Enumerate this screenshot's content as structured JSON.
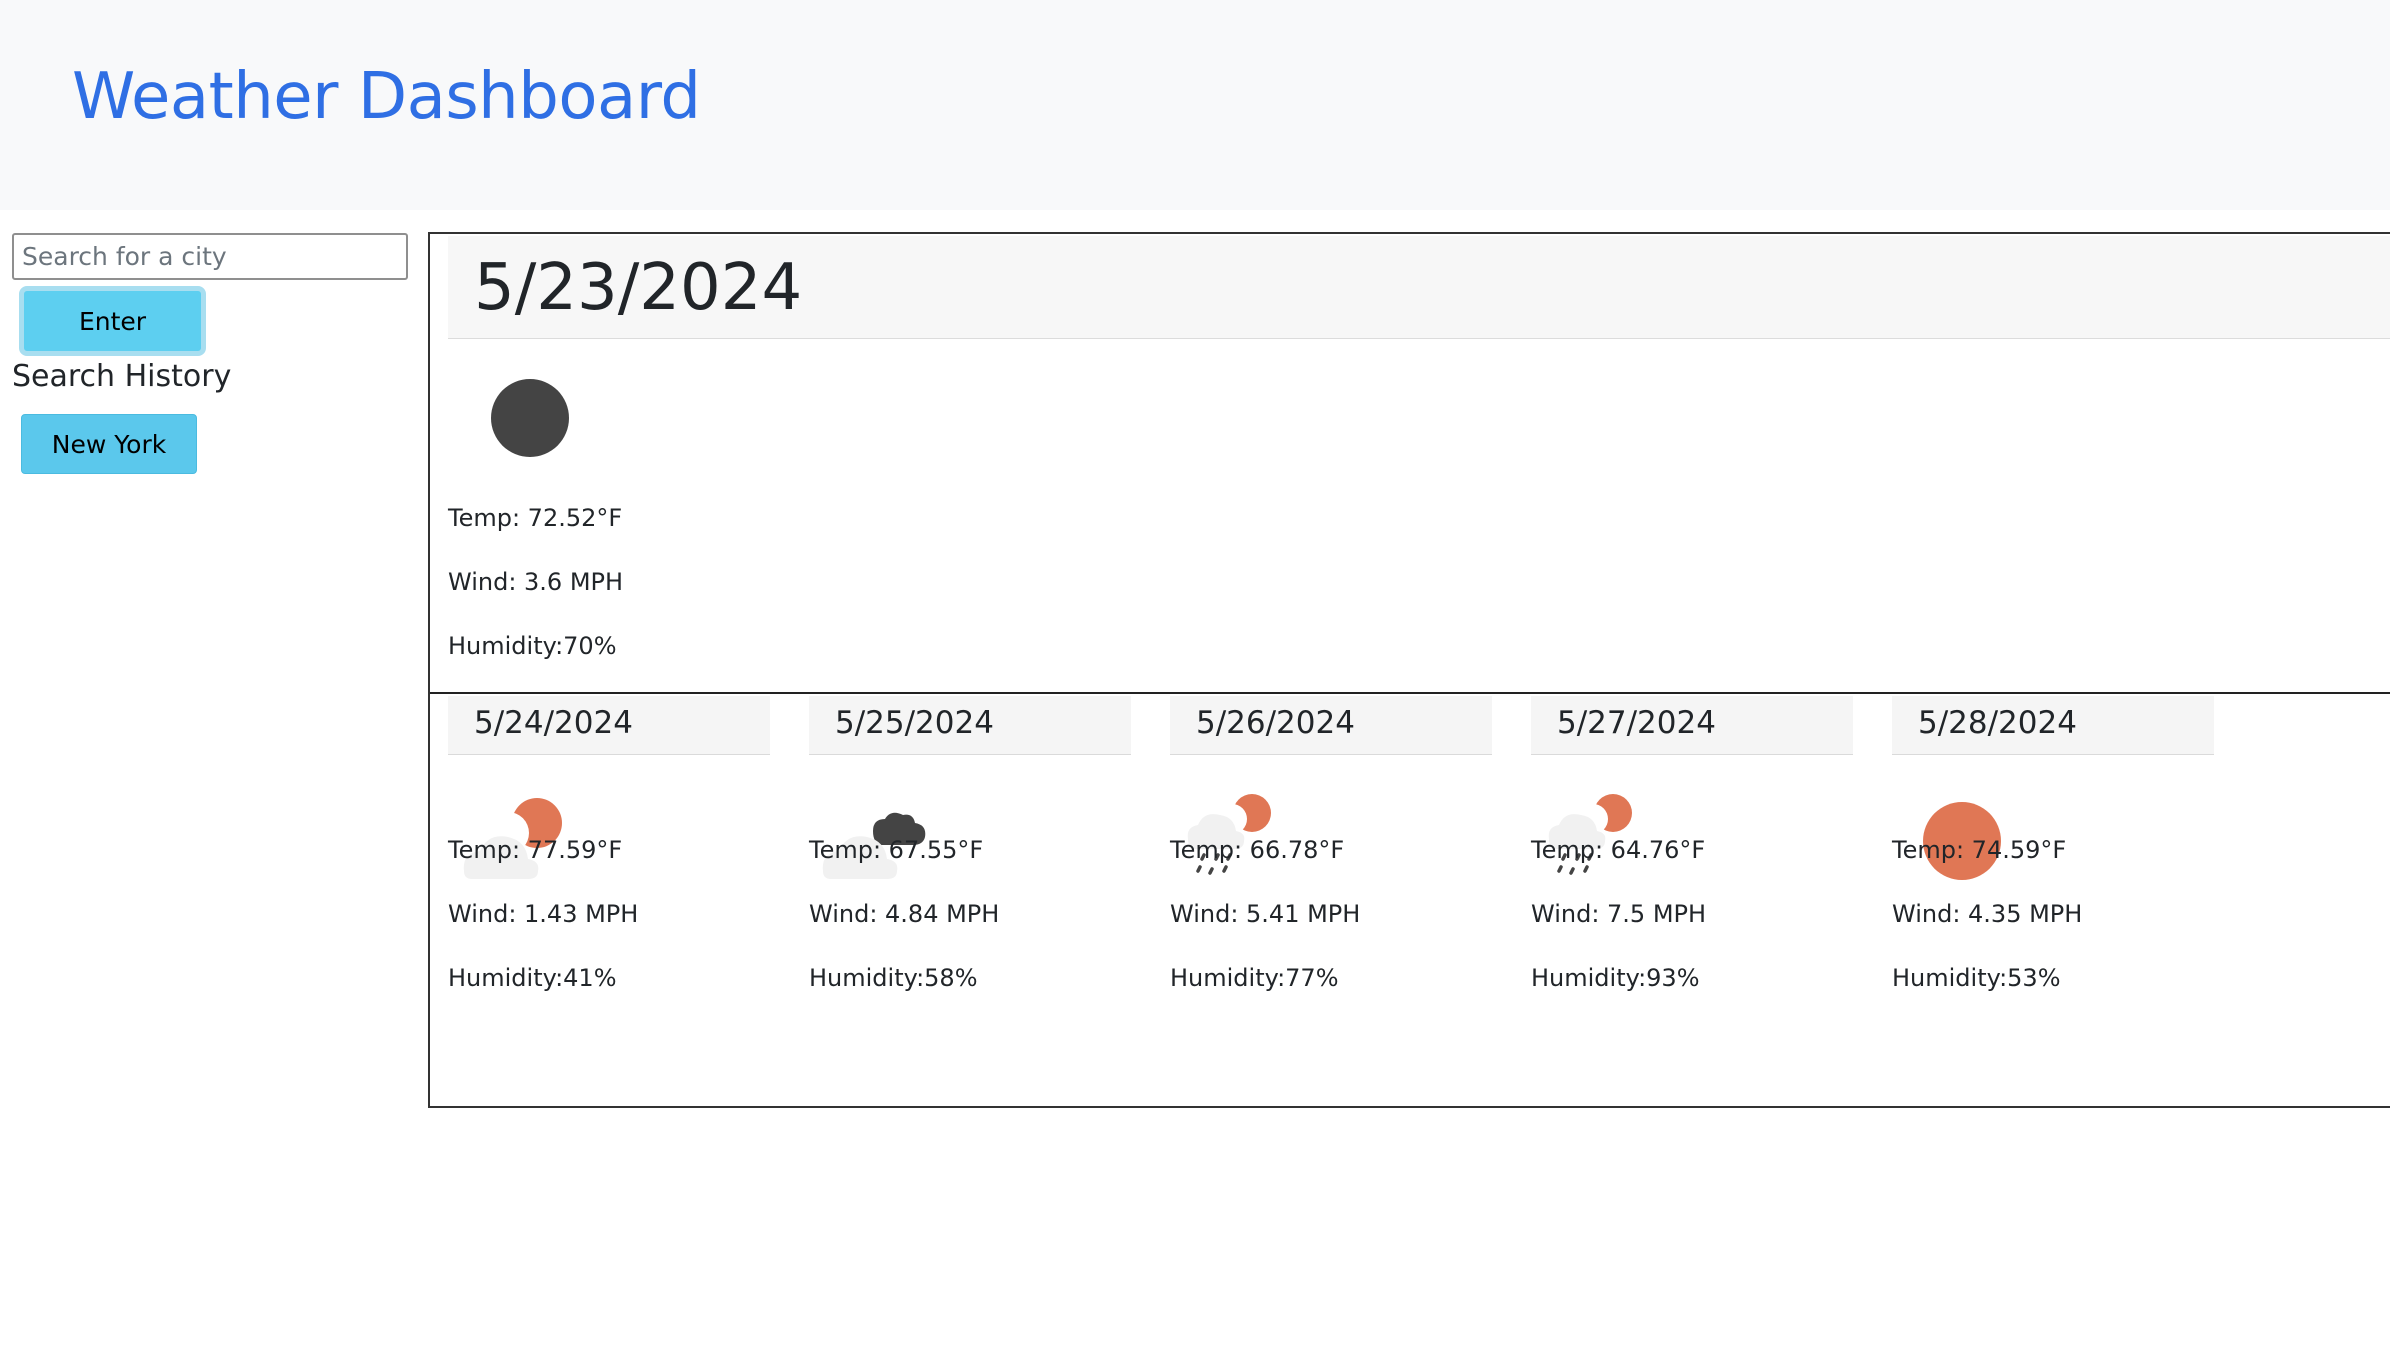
{
  "header": {
    "title": "Weather Dashboard"
  },
  "search": {
    "placeholder": "Search for a city",
    "value": "",
    "button_label": "Enter"
  },
  "history": {
    "title": "Search History",
    "items": [
      "New York"
    ]
  },
  "today": {
    "date": "5/23/2024",
    "icon": "moon-icon",
    "temp": "Temp: 72.52°F",
    "wind": "Wind: 3.6 MPH",
    "humidity": "Humidity:70%"
  },
  "forecast": [
    {
      "date": "5/24/2024",
      "icon": "partly-cloudy-sun-icon",
      "temp": "Temp: 77.59°F",
      "wind": "Wind: 1.43 MPH",
      "humidity": "Humidity:41%"
    },
    {
      "date": "5/25/2024",
      "icon": "cloudy-icon",
      "temp": "Temp: 67.55°F",
      "wind": "Wind: 4.84 MPH",
      "humidity": "Humidity:58%"
    },
    {
      "date": "5/26/2024",
      "icon": "rain-sun-icon",
      "temp": "Temp: 66.78°F",
      "wind": "Wind: 5.41 MPH",
      "humidity": "Humidity:77%"
    },
    {
      "date": "5/27/2024",
      "icon": "rain-sun-icon",
      "temp": "Temp: 64.76°F",
      "wind": "Wind: 7.5 MPH",
      "humidity": "Humidity:93%"
    },
    {
      "date": "5/28/2024",
      "icon": "sun-icon",
      "temp": "Temp: 74.59°F",
      "wind": "Wind: 4.35 MPH",
      "humidity": "Humidity:53%"
    }
  ],
  "colors": {
    "title": "#2f6fe4",
    "button": "#5dcff0",
    "sun": "#e07755",
    "moon": "#444444",
    "cloud": "#f1f1f1",
    "dark_cloud": "#444444"
  }
}
